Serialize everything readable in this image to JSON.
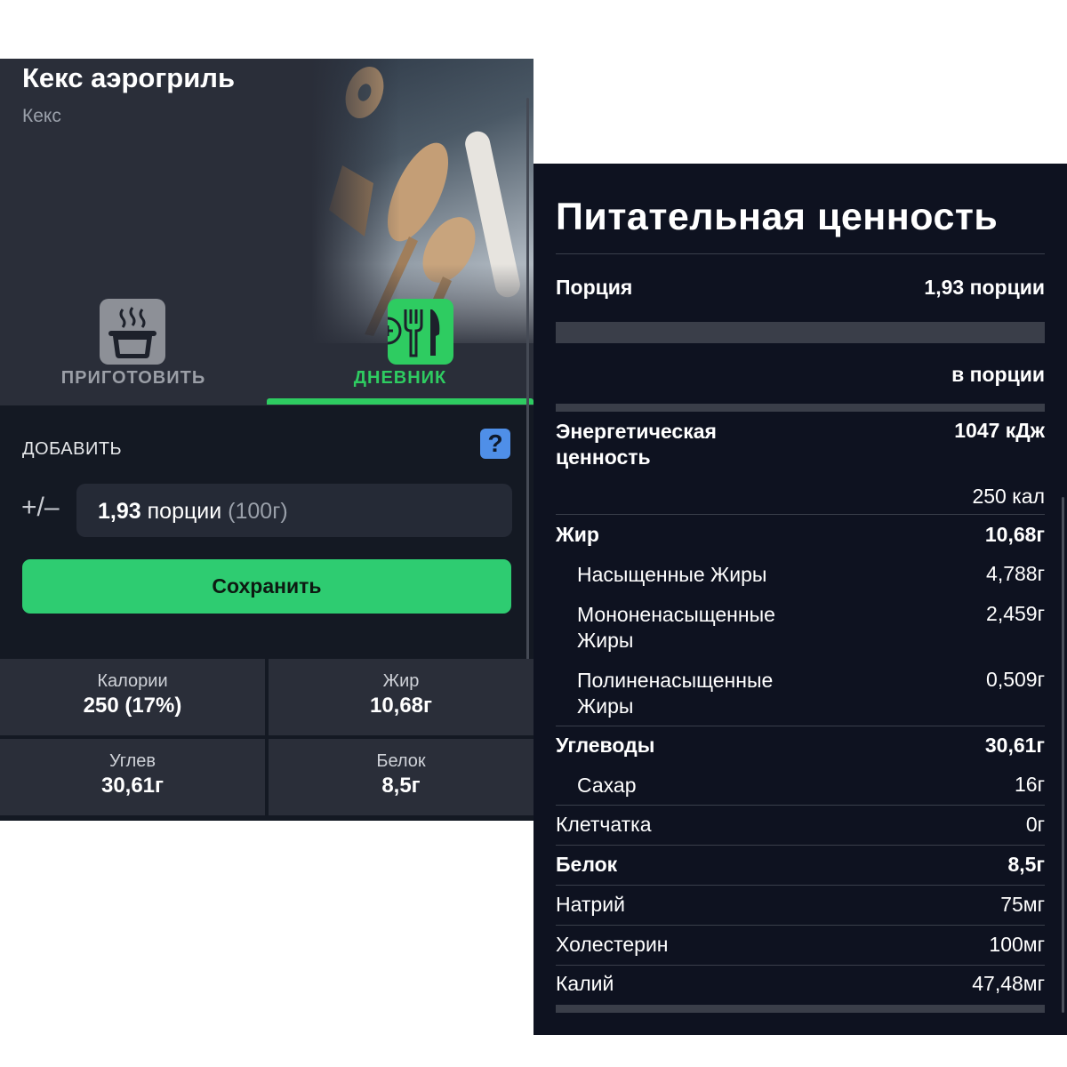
{
  "recipe": {
    "title": "Кекс аэрогриль",
    "subtitle": "Кекс"
  },
  "tabs": [
    {
      "label": "ПРИГОТОВИТЬ",
      "icon": "cooking-pot-icon",
      "active": false
    },
    {
      "label": "ДНЕВНИК",
      "icon": "add-to-diary-icon",
      "active": true
    }
  ],
  "add": {
    "label": "ДОБАВИТЬ",
    "help": "?",
    "plusminus": "+/–",
    "portion_number": "1,93",
    "portion_unit": "порции",
    "portion_grams": "(100г)",
    "save_label": "Сохранить"
  },
  "macros": [
    {
      "name": "Калории",
      "value": "250 (17%)"
    },
    {
      "name": "Жир",
      "value": "10,68г"
    },
    {
      "name": "Углев",
      "value": "30,61г"
    },
    {
      "name": "Белок",
      "value": "8,5г"
    }
  ],
  "nutrition": {
    "title": "Питательная ценность",
    "portion_label": "Порция",
    "portion_value": "1,93 порции",
    "per_portion": "в порции",
    "energy_label_1": "Энергетическая",
    "energy_label_2": "ценность",
    "energy_kj": "1047 кДж",
    "energy_kcal": "250 кал",
    "rows": [
      {
        "label": "Жир",
        "value": "10,68г"
      },
      {
        "label": "Насыщенные Жиры",
        "value": "4,788г"
      },
      {
        "label": "Мононенасыщенные",
        "label2": "Жиры",
        "value": "2,459г"
      },
      {
        "label": "Полиненасыщенные",
        "label2": "Жиры",
        "value": "0,509г"
      },
      {
        "label": "Углеводы",
        "value": "30,61г"
      },
      {
        "label": "Сахар",
        "value": "16г"
      },
      {
        "label": "Клетчатка",
        "value": "0г"
      },
      {
        "label": "Белок",
        "value": "8,5г"
      },
      {
        "label": "Натрий",
        "value": "75мг"
      },
      {
        "label": "Холестерин",
        "value": "100мг"
      },
      {
        "label": "Калий",
        "value": "47,48мг"
      }
    ]
  },
  "colors": {
    "accent_green": "#2ecc71",
    "panel_dark": "#141923",
    "panel_mid": "#2a2e39",
    "nutrition_bg": "#0e1220",
    "help_blue": "#4f8fe8"
  }
}
